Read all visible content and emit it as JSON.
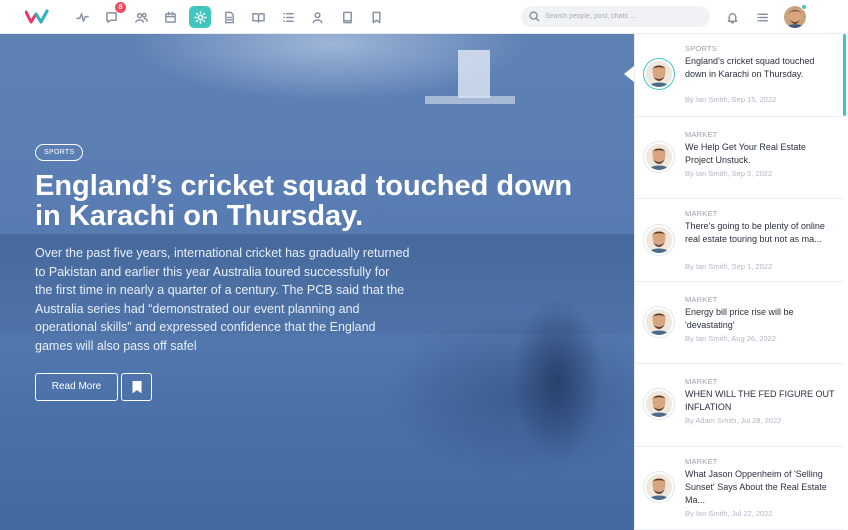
{
  "topbar": {
    "notification_count": "8",
    "search_placeholder": "Search people, post, chats ...",
    "icons": [
      "activity-icon",
      "chat-icon",
      "users-icon",
      "calendar-icon",
      "sun-icon",
      "document-icon",
      "book-open-icon",
      "list-icon",
      "user-icon",
      "book-icon",
      "bookmark-icon"
    ],
    "right_icons": [
      "bell-icon",
      "menu-icon"
    ],
    "accent_color": "#41c5c0"
  },
  "hero": {
    "tag": "SPORTS",
    "title": "England’s cricket squad touched down in Karachi on Thursday.",
    "body": "Over the past five years, international cricket has gradually returned to Pakistan and earlier this year Australia toured successfully for the first time in nearly a quarter of a century. The PCB said that the Australia series had “demonstrated our event planning and operational skills” and expressed confidence that the England games will also pass off safel",
    "read_more": "Read More"
  },
  "feed": [
    {
      "category": "SPORTS",
      "title": "England’s cricket squad touched down in Karachi on Thursday.",
      "meta": "By Ian Smith, Sep 15, 2022"
    },
    {
      "category": "MARKET",
      "title": "We Help Get Your Real Estate Project Unstuck.",
      "meta": "By Ian Smith, Sep 5, 2022"
    },
    {
      "category": "MARKET",
      "title": "There’s going to be plenty of online real estate touring but not as ma...",
      "meta": "By Ian Smith, Sep 1, 2022"
    },
    {
      "category": "MARKET",
      "title": "Energy bill price rise will be 'devastating'",
      "meta": "By Ian Smith, Aug 26, 2022"
    },
    {
      "category": "MARKET",
      "title": "WHEN WILL THE FED FIGURE OUT INFLATION",
      "meta": "By Adam Smith, Jul 28, 2022"
    },
    {
      "category": "MARKET",
      "title": "What Jason Oppenheim of 'Selling Sunset' Says About the Real Estate Ma...",
      "meta": "By Ian Smith, Jul 22, 2022"
    }
  ]
}
